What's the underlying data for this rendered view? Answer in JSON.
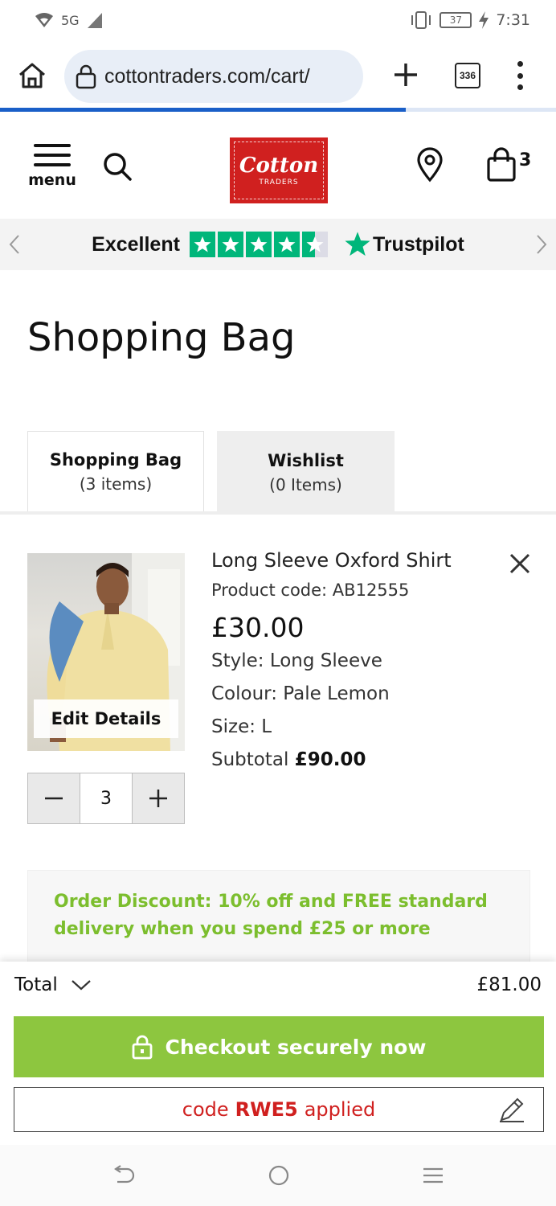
{
  "status_bar": {
    "network": "5G",
    "battery": "37",
    "time": "7:31"
  },
  "browser": {
    "url": "cottontraders.com/cart/",
    "tab_count": "336",
    "load_progress": 0.73
  },
  "header": {
    "menu_label": "menu",
    "logo_main": "Cotton",
    "logo_sub": "TRADERS",
    "bag_count": "3",
    "brand_color": "#d0201f"
  },
  "trustpilot": {
    "rating_text": "Excellent",
    "stars": 4.5,
    "brand": "Trustpilot",
    "star_color": "#00b67a"
  },
  "page": {
    "title": "Shopping Bag"
  },
  "tabs": [
    {
      "label": "Shopping Bag",
      "count": "(3 items)",
      "active": true
    },
    {
      "label": "Wishlist",
      "count": "(0 Items)",
      "active": false
    }
  ],
  "product": {
    "name": "Long Sleeve Oxford Shirt",
    "code": "Product code: AB12555",
    "price": "£30.00",
    "style": "Style: Long Sleeve",
    "colour": "Colour: Pale Lemon",
    "size": "Size: L",
    "subtotal_label": "Subtotal",
    "subtotal_value": "£90.00",
    "edit_label": "Edit Details",
    "quantity": "3"
  },
  "discount": {
    "text": "Order Discount: 10% off and FREE standard delivery when you spend £25 or more",
    "color": "#7cbe2e"
  },
  "checkout": {
    "total_label": "Total",
    "total_value": "£81.00",
    "button_label": "Checkout securely now",
    "button_color": "#8dc63f",
    "code_prefix": "code",
    "code": "RWE5",
    "code_suffix": "applied"
  }
}
